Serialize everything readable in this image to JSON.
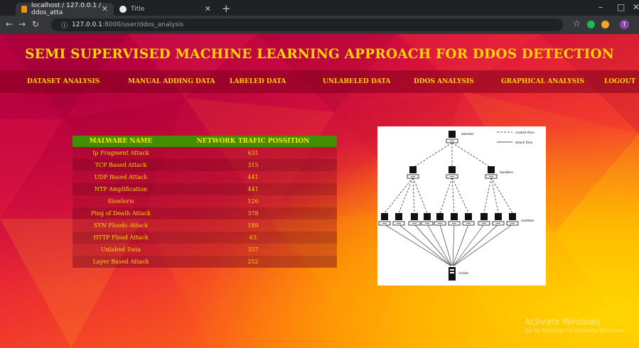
{
  "browser": {
    "tabs": [
      {
        "label": "localhost / 127.0.0.1 / ddos_atta",
        "active": true
      },
      {
        "label": "Title",
        "active": false
      }
    ],
    "url_host": "127.0.0.1",
    "url_path": ":8000/user/ddos_analysis",
    "profile_initial": "T"
  },
  "page": {
    "title": "SEMI SUPERVISED MACHINE LEARNING APPROACH FOR DDOS DETECTION",
    "menu": [
      "DATASET ANALYSIS",
      "MANUAL ADDING DATA",
      "LABELED DATA",
      "UNLABELED DATA",
      "DDOS ANALYSIS",
      "GRAPHICAL ANALYSIS",
      "LOGOUT"
    ],
    "table": {
      "headers": [
        "MALWARE NAME",
        "NETWORK TRAFIC POSSITION"
      ],
      "rows": [
        [
          "Ip Fragment Attack",
          "631"
        ],
        [
          "TCP Based Attack",
          "315"
        ],
        [
          "UDP Based Attack",
          "441"
        ],
        [
          "NTP Amplification",
          "441"
        ],
        [
          "Slowloris",
          "126"
        ],
        [
          "Ping of Death Attack",
          "378"
        ],
        [
          "SYN Floods Attack",
          "189"
        ],
        [
          "HTTP Flood Attack",
          "63"
        ],
        [
          "Unlabed Data",
          "337"
        ],
        [
          "Layer Based Attack",
          "252"
        ]
      ]
    },
    "diagram": {
      "legend": [
        "control flow",
        "attack flow"
      ],
      "labels": [
        "attacker",
        "handlers",
        "zombies",
        "victim"
      ]
    },
    "watermark": {
      "line1": "Activate Windows",
      "line2": "Go to Settings to activate Windows."
    }
  },
  "colors": {
    "title": "#ffd400",
    "menu_text": "#ffd400",
    "table_header_bg": "#3f8f00"
  }
}
